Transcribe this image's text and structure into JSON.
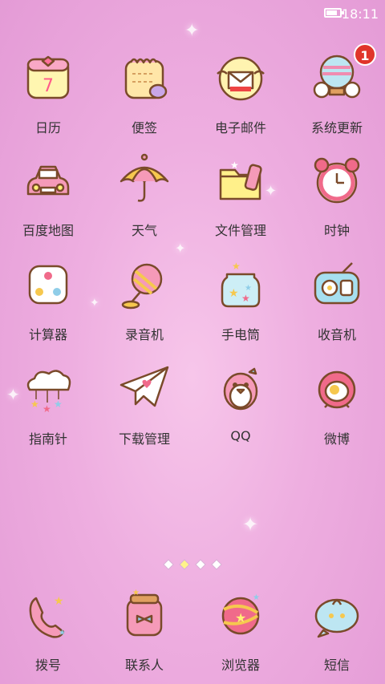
{
  "status_bar": {
    "time": "18:11",
    "battery_level": 0.8
  },
  "apps": [
    [
      {
        "label": "日历",
        "icon": "calendar-icon"
      },
      {
        "label": "便签",
        "icon": "notes-icon"
      },
      {
        "label": "电子邮件",
        "icon": "email-icon"
      },
      {
        "label": "系统更新",
        "icon": "system-update-icon",
        "badge": "1"
      }
    ],
    [
      {
        "label": "百度地图",
        "icon": "car-map-icon"
      },
      {
        "label": "天气",
        "icon": "umbrella-icon"
      },
      {
        "label": "文件管理",
        "icon": "folder-icon"
      },
      {
        "label": "时钟",
        "icon": "alarm-clock-icon"
      }
    ],
    [
      {
        "label": "计算器",
        "icon": "dice-icon"
      },
      {
        "label": "录音机",
        "icon": "microphone-icon"
      },
      {
        "label": "手电筒",
        "icon": "star-jar-icon"
      },
      {
        "label": "收音机",
        "icon": "radio-icon"
      }
    ],
    [
      {
        "label": "指南针",
        "icon": "cloud-stars-icon"
      },
      {
        "label": "下载管理",
        "icon": "paper-plane-icon"
      },
      {
        "label": "QQ",
        "icon": "penguin-icon"
      },
      {
        "label": "微博",
        "icon": "bird-icon"
      }
    ]
  ],
  "pager": {
    "pages": 4,
    "active": 1
  },
  "dock": [
    {
      "label": "拨号",
      "icon": "phone-icon"
    },
    {
      "label": "联系人",
      "icon": "contacts-icon"
    },
    {
      "label": "浏览器",
      "icon": "planet-icon"
    },
    {
      "label": "短信",
      "icon": "message-bubble-icon"
    }
  ]
}
